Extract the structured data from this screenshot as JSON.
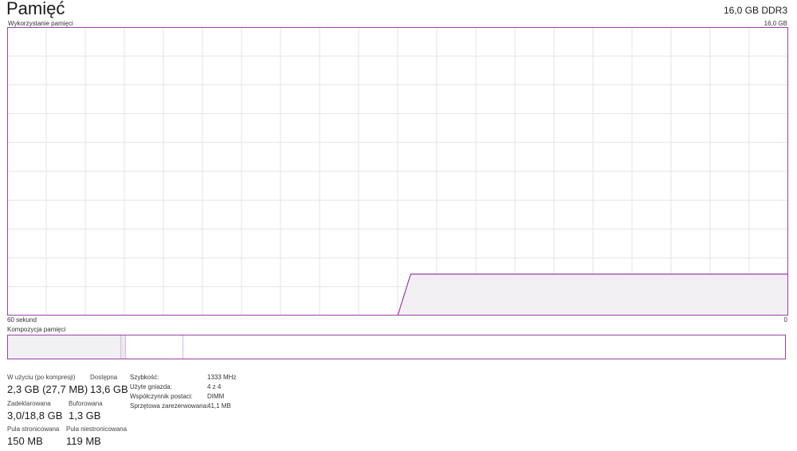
{
  "header": {
    "title": "Pamięć",
    "spec": "16,0 GB DDR3"
  },
  "usage_graph": {
    "label": "Wykorzystanie pamięci",
    "max_label": "16,0 GB",
    "time_left": "60 sekund",
    "time_right": "0",
    "line_color": "#9a3fa6",
    "fill_color": "#f2eff3",
    "grid_color": "#e8e2ea",
    "series_gb": [
      0,
      0,
      0,
      0,
      0,
      0,
      0,
      0,
      0,
      0,
      0,
      0,
      0,
      0,
      0,
      0,
      0,
      0,
      0,
      0,
      0,
      0,
      0,
      0,
      0,
      0,
      0,
      0,
      0,
      0,
      0,
      2.3,
      2.3,
      2.3,
      2.3,
      2.3,
      2.3,
      2.3,
      2.3,
      2.3,
      2.3,
      2.3,
      2.3,
      2.3,
      2.3,
      2.3,
      2.3,
      2.3,
      2.3,
      2.3,
      2.3,
      2.3,
      2.3,
      2.3,
      2.3,
      2.3,
      2.3,
      2.3,
      2.3,
      2.3,
      2.3
    ],
    "max_gb": 16
  },
  "composition": {
    "label": "Kompozycja pamięci"
  },
  "stats": {
    "in_use_label": "W użyciu (po kompresji)",
    "in_use_value": "2,3 GB (27,7 MB)",
    "available_label": "Dostępna",
    "available_value": "13,6 GB",
    "committed_label": "Zadeklarowana",
    "committed_value": "3,0/18,8 GB",
    "cached_label": "Buforowana",
    "cached_value": "1,3 GB",
    "paged_label": "Pula stronicowana",
    "paged_value": "150 MB",
    "nonpaged_label": "Pula niestronicowana",
    "nonpaged_value": "119 MB"
  },
  "details": {
    "speed_label": "Szybkość:",
    "speed_value": "1333 MHz",
    "slots_label": "Użyte gniazda:",
    "slots_value": "4 z 4",
    "form_label": "Współczynnik postaci:",
    "form_value": "DIMM",
    "reserved_label": "Sprzętowa zarezerwowana:",
    "reserved_value": "41,1 MB"
  }
}
